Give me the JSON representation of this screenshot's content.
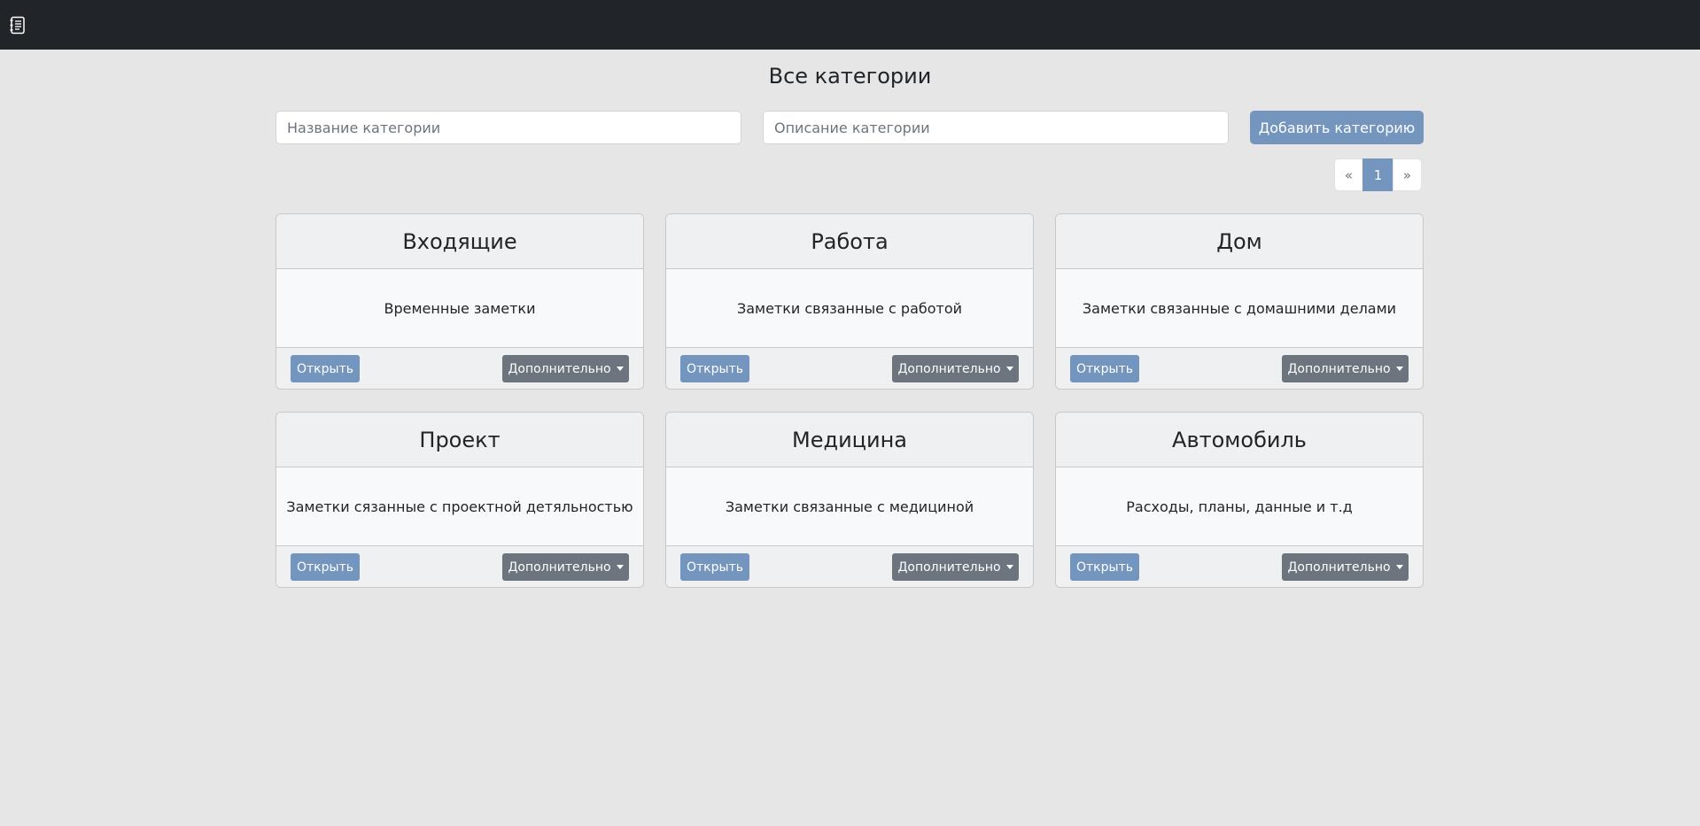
{
  "header": {
    "logo_icon": "notebook-icon"
  },
  "page_title": "Все категории",
  "form": {
    "name_placeholder": "Название категории",
    "description_placeholder": "Описание категории",
    "add_label": "Добавить категорию"
  },
  "pagination": {
    "prev": "«",
    "current": "1",
    "next": "»"
  },
  "cards": [
    {
      "title": "Входящие",
      "description": "Временные заметки",
      "open_label": "Открыть",
      "more_label": "Дополнительно"
    },
    {
      "title": "Работа",
      "description": "Заметки связанные с работой",
      "open_label": "Открыть",
      "more_label": "Дополнительно"
    },
    {
      "title": "Дом",
      "description": "Заметки связанные с домашними делами",
      "open_label": "Открыть",
      "more_label": "Дополнительно"
    },
    {
      "title": "Проект",
      "description": "Заметки сязанные с проектной детяльностью",
      "open_label": "Открыть",
      "more_label": "Дополнительно"
    },
    {
      "title": "Медицина",
      "description": "Заметки связанные с медициной",
      "open_label": "Открыть",
      "more_label": "Дополнительно"
    },
    {
      "title": "Автомобиль",
      "description": "Расходы, планы, данные и т.д",
      "open_label": "Открыть",
      "more_label": "Дополнительно"
    }
  ],
  "colors": {
    "navbar": "#212529",
    "primary": "#7496be",
    "secondary": "#6c757d",
    "background": "#e6e6e6"
  }
}
